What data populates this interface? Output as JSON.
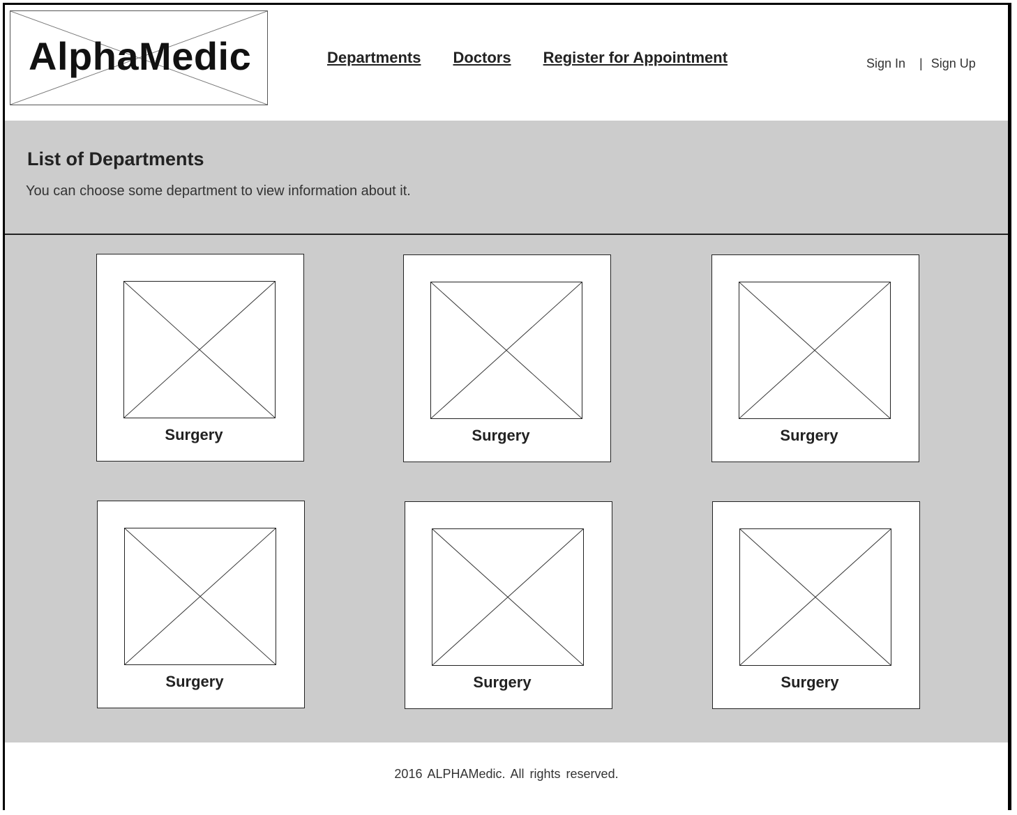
{
  "header": {
    "logo_text": "AlphaMedic",
    "nav": [
      {
        "label": "Departments"
      },
      {
        "label": "Doctors"
      },
      {
        "label": "Register for Appointment"
      }
    ],
    "sign_in": "Sign In",
    "separator": "|",
    "sign_up": "Sign Up"
  },
  "intro": {
    "title": "List of Departments",
    "subtitle": "You can choose some department to view information about it."
  },
  "departments": [
    {
      "name": "Surgery",
      "image_icon": "image-placeholder-icon"
    },
    {
      "name": "Surgery",
      "image_icon": "image-placeholder-icon"
    },
    {
      "name": "Surgery",
      "image_icon": "image-placeholder-icon"
    },
    {
      "name": "Surgery",
      "image_icon": "image-placeholder-icon"
    },
    {
      "name": "Surgery",
      "image_icon": "image-placeholder-icon"
    },
    {
      "name": "Surgery",
      "image_icon": "image-placeholder-icon"
    }
  ],
  "footer": {
    "copyright": "2016 ALPHAMedic. All rights reserved."
  },
  "colors": {
    "band_background": "#cccccc",
    "card_background": "#ffffff",
    "border": "#222222"
  }
}
